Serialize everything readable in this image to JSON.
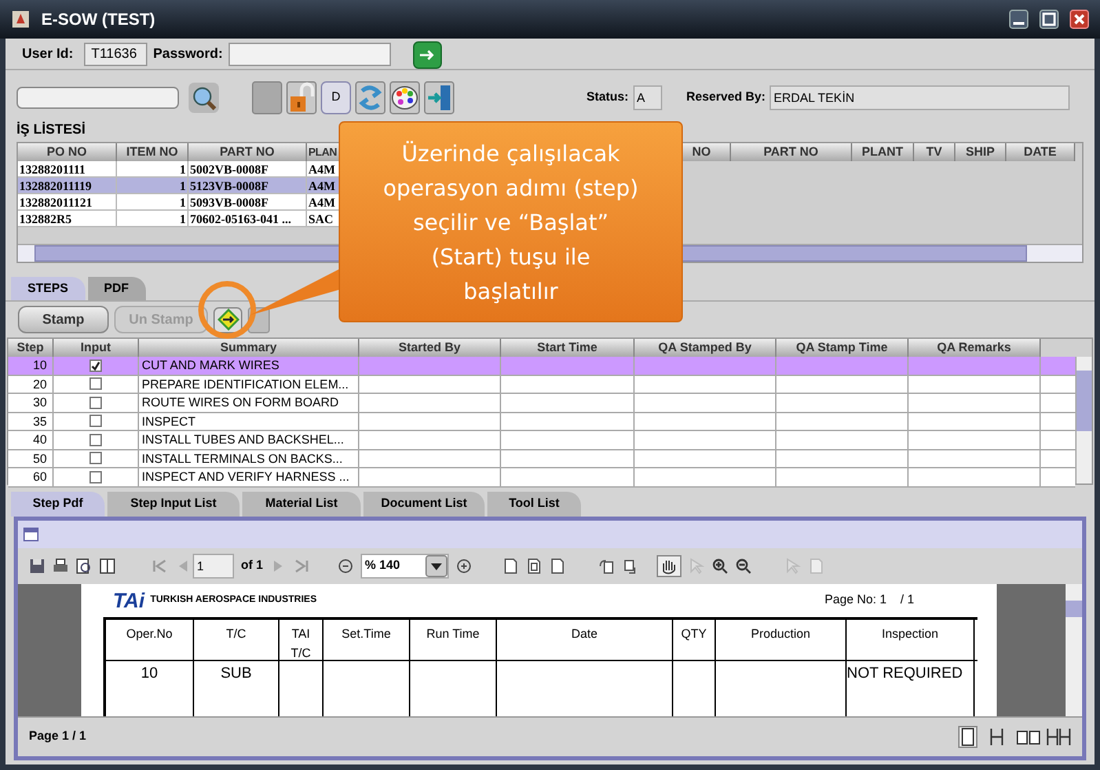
{
  "window": {
    "title": "E-SOW (TEST)"
  },
  "login": {
    "user_id_label": "User Id:",
    "user_id": "T11636",
    "password_label": "Password:"
  },
  "toolbar": {
    "d_button": "D"
  },
  "status": {
    "label": "Status:",
    "value": "A"
  },
  "reserved_by": {
    "label": "Reserved By:",
    "value": "ERDAL TEKİN"
  },
  "work_list": {
    "title": "İŞ LİSTESİ",
    "columns": [
      "PO NO",
      "ITEM NO",
      "PART NO",
      "PLAN"
    ],
    "rows": [
      {
        "cells": [
          "13288201111",
          "1",
          "5002VB-0008F",
          "A4M"
        ],
        "selected": false
      },
      {
        "cells": [
          "132882011119",
          "1",
          "5123VB-0008F",
          "A4M"
        ],
        "selected": true
      },
      {
        "cells": [
          "132882011121",
          "1",
          "5093VB-0008F",
          "A4M"
        ],
        "selected": false
      },
      {
        "cells": [
          "132882R5",
          "1",
          "70602-05163-041 ...",
          "SAC"
        ],
        "selected": false
      }
    ],
    "columns_right": [
      "NO",
      "PART NO",
      "PLANT",
      "TV",
      "SHIP",
      "DATE"
    ]
  },
  "callout": {
    "text": "Üzerinde çalışılacak operasyon adımı (step) seçilir ve “Başlat” (Start)  tuşu ile başlatılır"
  },
  "tabs": [
    {
      "label": "STEPS",
      "selected": true
    },
    {
      "label": "PDF",
      "selected": false
    }
  ],
  "step_buttons": [
    {
      "label": "Stamp",
      "disabled": false
    },
    {
      "label": "Un Stamp",
      "disabled": true
    }
  ],
  "steps": {
    "columns": [
      "Step",
      "Input",
      "Summary",
      "Started By",
      "Start Time",
      "QA Stamped By",
      "QA Stamp Time",
      "QA Remarks"
    ],
    "rows": [
      {
        "step": "10",
        "input": true,
        "summary": "CUT AND MARK WIRES",
        "selected": true
      },
      {
        "step": "20",
        "input": false,
        "summary": "PREPARE IDENTIFICATION ELEM...",
        "selected": false
      },
      {
        "step": "30",
        "input": false,
        "summary": "ROUTE WIRES ON FORM BOARD",
        "selected": false
      },
      {
        "step": "35",
        "input": false,
        "summary": "INSPECT",
        "selected": false
      },
      {
        "step": "40",
        "input": false,
        "summary": "INSTALL TUBES AND BACKSHEL...",
        "selected": false
      },
      {
        "step": "50",
        "input": false,
        "summary": "INSTALL TERMINALS ON BACKS...",
        "selected": false
      },
      {
        "step": "60",
        "input": false,
        "summary": "INSPECT AND VERIFY HARNESS ...",
        "selected": false
      }
    ]
  },
  "bottom_tabs": [
    {
      "label": "Step Pdf",
      "selected": true
    },
    {
      "label": "Step Input List",
      "selected": false
    },
    {
      "label": "Material List",
      "selected": false
    },
    {
      "label": "Document List",
      "selected": false
    },
    {
      "label": "Tool List",
      "selected": false
    }
  ],
  "pdf_viewer": {
    "page_field": "1",
    "page_of": "of 1",
    "zoom": "% 140",
    "status": "Page 1 / 1"
  },
  "document": {
    "logo": "TAi",
    "company": "TURKISH AEROSPACE INDUSTRIES",
    "page_no": "Page No: 1    / 1",
    "columns": [
      "Oper.No",
      "T/C",
      "TAI T/C",
      "Set.Time",
      "Run Time",
      "Date",
      "QTY",
      "Production",
      "Inspection"
    ],
    "row": {
      "oper_no": "10",
      "tc": "SUB",
      "inspection": "NOT REQUIRED"
    }
  }
}
